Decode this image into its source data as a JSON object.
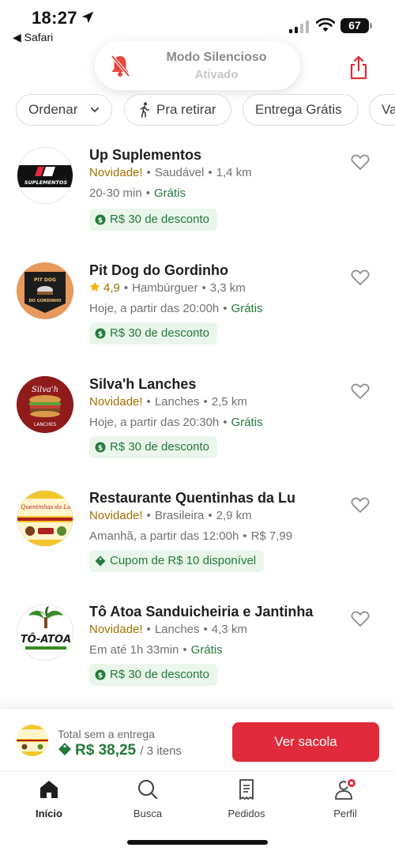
{
  "status_bar": {
    "time": "18:27",
    "back_app": "◀ Safari",
    "battery": "67"
  },
  "silent_mode": {
    "title": "Modo Silencioso",
    "subtitle": "Ativado"
  },
  "filters": {
    "sort_label": "Ordenar",
    "pickup_label": "Pra retirar",
    "free_delivery_label": "Entrega Grátis",
    "partial_label": "Va"
  },
  "restaurants": [
    {
      "name": "Up Suplementos",
      "tag": "Novidade!",
      "category": "Saudável",
      "distance": "1,4 km",
      "time": "20-30 min",
      "delivery": "Grátis",
      "promo": "R$ 30 de desconto"
    },
    {
      "name": "Pit Dog do Gordinho",
      "rating": "4,9",
      "category": "Hambúrguer",
      "distance": "3,3 km",
      "time": "Hoje, a partir das 20:00h",
      "delivery": "Grátis",
      "promo": "R$ 30 de desconto"
    },
    {
      "name": "Silva'h Lanches",
      "tag": "Novidade!",
      "category": "Lanches",
      "distance": "2,5 km",
      "time": "Hoje, a partir das 20:30h",
      "delivery": "Grátis",
      "promo": "R$ 30 de desconto"
    },
    {
      "name": "Restaurante Quentinhas da Lu",
      "tag": "Novidade!",
      "category": "Brasileira",
      "distance": "2,9 km",
      "time": "Amanhã, a partir das 12:00h",
      "delivery": "R$ 7,99",
      "promo": "Cupom de R$ 10 disponível"
    },
    {
      "name": "Tô Atoa Sanduicheiria e Jantinha",
      "tag": "Novidade!",
      "category": "Lanches",
      "distance": "4,3 km",
      "time": "Em até 1h 33min",
      "delivery": "Grátis",
      "promo": "R$ 30 de desconto"
    }
  ],
  "logo_text": {
    "up": "SUPLEMENTOS",
    "pitdog_top": "PIT DOG",
    "pitdog_bottom": "DO GORDINHO",
    "silvah": "Silva'h",
    "silvah_bottom": "LANCHES",
    "quentinhas": "Quentinhas da Lu",
    "toatoa": "TÔ-ATOA"
  },
  "bag": {
    "label": "Total sem a entrega",
    "total": "R$ 38,25",
    "items": "/ 3 itens",
    "button": "Ver sacola"
  },
  "nav": {
    "home": "Início",
    "search": "Busca",
    "orders": "Pedidos",
    "profile": "Perfil"
  },
  "colors": {
    "brand_red": "#e12a3a",
    "green": "#237a3a",
    "new_tag": "#a07000"
  }
}
